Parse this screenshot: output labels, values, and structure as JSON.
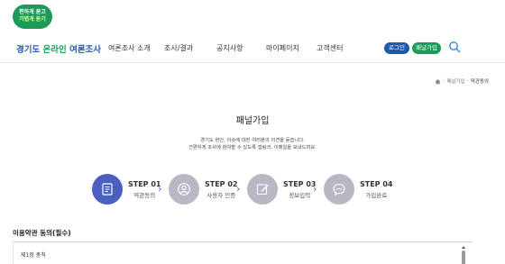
{
  "logo": {
    "line1": "편하게 묻고",
    "line2": "가볍게 듣기"
  },
  "brand": {
    "prefix": "경기도 ",
    "highlight": "온라인",
    "suffix": " 여론조사"
  },
  "nav": {
    "items": [
      {
        "label": "여론조사 소개"
      },
      {
        "label": "조사/결과"
      },
      {
        "label": "공지사항"
      },
      {
        "label": "마이페이지"
      },
      {
        "label": "고객센터"
      }
    ],
    "login_label": "로그인",
    "join_label": "패널가입",
    "search_icon": "search-icon"
  },
  "breadcrumb": {
    "home_icon": "home-icon",
    "parent": "패널가입",
    "current": "약관동의"
  },
  "page": {
    "title": "패널가입",
    "intro_line1": "경기도 현안, 이슈에 대한 여러분의 의견을 듣습니다.",
    "intro_line2": "간편하게 조사에 참여할 수 있도록 앱링크, 이메일을 보내드려요."
  },
  "steps": [
    {
      "num": "STEP 01",
      "label": "약관동의",
      "icon": "document-list-icon",
      "active": true
    },
    {
      "num": "STEP 02",
      "label": "사용자 인증",
      "icon": "user-icon",
      "active": false
    },
    {
      "num": "STEP 03",
      "label": "정보입력",
      "icon": "edit-icon",
      "active": false
    },
    {
      "num": "STEP 04",
      "label": "가입완료",
      "icon": "chat-icon",
      "active": false
    }
  ],
  "terms": {
    "heading": "이용약관 동의(필수)",
    "chapter": "제1장 총칙"
  },
  "colors": {
    "brand_blue": "#1f5aa8",
    "brand_green": "#1d9a5a",
    "step_active": "#4a5fbf",
    "step_inactive": "#b8b8c4"
  }
}
